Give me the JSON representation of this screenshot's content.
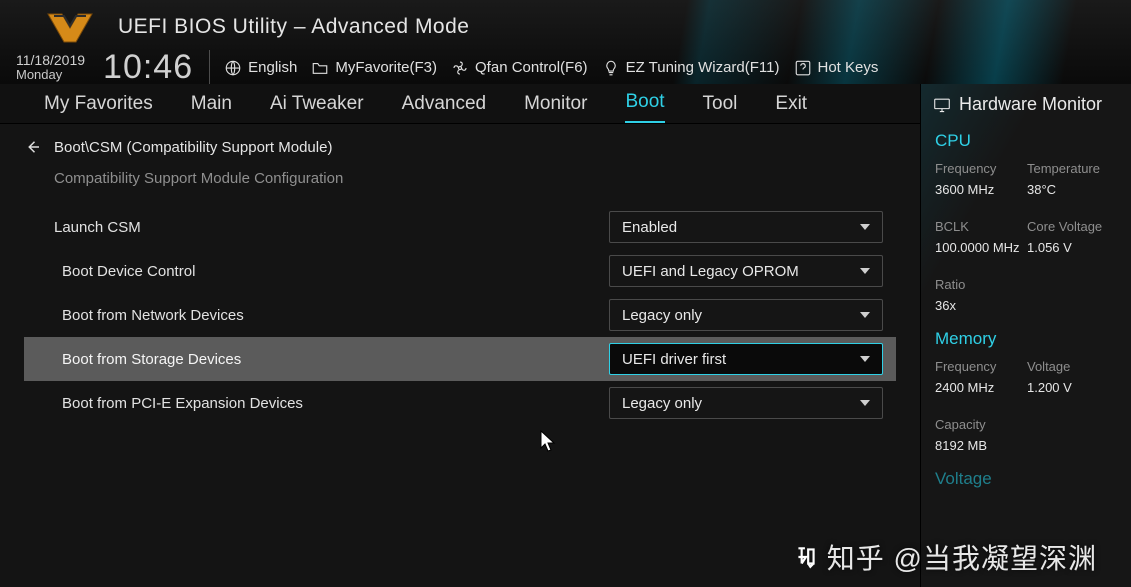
{
  "header": {
    "title": "UEFI BIOS Utility – Advanced Mode",
    "date": "11/18/2019",
    "day": "Monday",
    "time": "10:46",
    "language_label": "English",
    "myfavorite_label": "MyFavorite(F3)",
    "qfan_label": "Qfan Control(F6)",
    "ez_label": "EZ Tuning Wizard(F11)",
    "hotkeys_label": "Hot Keys"
  },
  "tabs": [
    {
      "label": "My Favorites",
      "active": false
    },
    {
      "label": "Main",
      "active": false
    },
    {
      "label": "Ai Tweaker",
      "active": false
    },
    {
      "label": "Advanced",
      "active": false
    },
    {
      "label": "Monitor",
      "active": false
    },
    {
      "label": "Boot",
      "active": true
    },
    {
      "label": "Tool",
      "active": false
    },
    {
      "label": "Exit",
      "active": false
    }
  ],
  "main": {
    "breadcrumb": "Boot\\CSM (Compatibility Support Module)",
    "section_title": "Compatibility Support Module Configuration",
    "rows": [
      {
        "label": "Launch CSM",
        "value": "Enabled",
        "sub": false,
        "selected": false
      },
      {
        "label": "Boot Device Control",
        "value": "UEFI and Legacy OPROM",
        "sub": true,
        "selected": false
      },
      {
        "label": "Boot from Network Devices",
        "value": "Legacy only",
        "sub": true,
        "selected": false
      },
      {
        "label": "Boot from Storage Devices",
        "value": "UEFI driver first",
        "sub": true,
        "selected": true
      },
      {
        "label": "Boot from PCI-E Expansion Devices",
        "value": "Legacy only",
        "sub": true,
        "selected": false
      }
    ]
  },
  "side": {
    "title": "Hardware Monitor",
    "cpu": {
      "heading": "CPU",
      "freq_k": "Frequency",
      "freq_v": "3600 MHz",
      "temp_k": "Temperature",
      "temp_v": "38°C",
      "bclk_k": "BCLK",
      "bclk_v": "100.0000 MHz",
      "cvolt_k": "Core Voltage",
      "cvolt_v": "1.056 V",
      "ratio_k": "Ratio",
      "ratio_v": "36x"
    },
    "memory": {
      "heading": "Memory",
      "freq_k": "Frequency",
      "freq_v": "2400 MHz",
      "volt_k": "Voltage",
      "volt_v": "1.200 V",
      "cap_k": "Capacity",
      "cap_v": "8192 MB"
    },
    "voltage": {
      "heading": "Voltage"
    }
  },
  "watermark": "知乎 @当我凝望深渊"
}
